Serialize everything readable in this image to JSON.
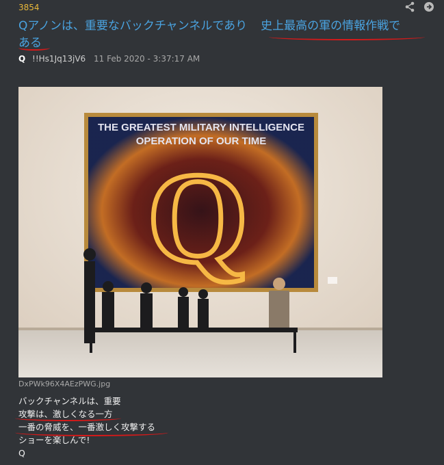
{
  "post": {
    "number": "3854",
    "title_part1": "Qアノンは、重要なバックチャンネルであり",
    "title_part2": "史上最高の軍の情報作戦で",
    "title_part3": "ある",
    "author": "Q",
    "tripcode": "!!Hs1Jq13jV6",
    "date": "11 Feb 2020 - 3:37:17 AM"
  },
  "image": {
    "filename": "DxPWk96X4AEzPWG.jpg",
    "caption_line1": "THE GREATEST MILITARY INTELLIGENCE",
    "caption_line2": "OPERATION OF OUR TIME",
    "letter": "Q"
  },
  "body": {
    "lines": [
      "バックチャンネルは、重要",
      "攻撃は、激しくなる一方",
      "一番の脅威を、一番激しく攻撃する",
      "ショーを楽しんで!",
      "Q"
    ]
  },
  "icons": {
    "share": "share-icon",
    "goto": "arrow-right-circle-icon"
  },
  "colors": {
    "background": "#313438",
    "title": "#4aa3e0",
    "post_number": "#e8b83a",
    "underline": "#d21a1a"
  }
}
